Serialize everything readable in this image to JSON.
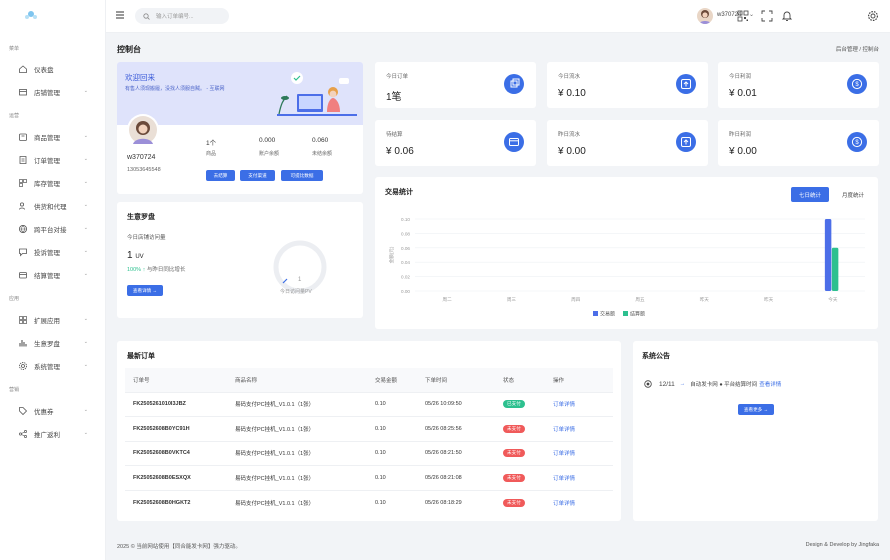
{
  "sidebar": {
    "sections": [
      "菜单",
      "运营",
      "应用",
      "营销"
    ],
    "items": [
      {
        "label": "仪表盘",
        "icon": "home-icon",
        "chev": false
      },
      {
        "label": "店铺管理",
        "icon": "store-icon",
        "chev": true
      },
      {
        "label": "商品管理",
        "icon": "goods-icon",
        "chev": true
      },
      {
        "label": "订单管理",
        "icon": "order-icon",
        "chev": true
      },
      {
        "label": "库存管理",
        "icon": "stock-icon",
        "chev": true
      },
      {
        "label": "供货和代理",
        "icon": "users-icon",
        "chev": true
      },
      {
        "label": "跨平台对接",
        "icon": "globe-icon",
        "chev": true
      },
      {
        "label": "投诉管理",
        "icon": "complaint-icon",
        "chev": true
      },
      {
        "label": "结算管理",
        "icon": "wallet-icon",
        "chev": true
      },
      {
        "label": "扩展应用",
        "icon": "apps-icon",
        "chev": true
      },
      {
        "label": "生意罗盘",
        "icon": "bar-chart-icon",
        "chev": true
      },
      {
        "label": "系统管理",
        "icon": "gear-icon",
        "chev": true
      },
      {
        "label": "优惠券",
        "icon": "tag-icon",
        "chev": true
      },
      {
        "label": "推广返利",
        "icon": "share-icon",
        "chev": true
      }
    ]
  },
  "topbar": {
    "search_placeholder": "输入订单编号...",
    "username": "w370724",
    "user_chevron": "⌄"
  },
  "page": {
    "title": "控制台",
    "breadcrumb": "后台管理 / 控制台"
  },
  "welcome": {
    "title": "欢迎回来",
    "subtitle": "有售人须现搬履，没找人须服自贼。 - 互联网",
    "user": "w370724",
    "phone": "13053645548",
    "stats": [
      {
        "value": "1个",
        "label": "商品"
      },
      {
        "value": "0.000",
        "label": "账户余额"
      },
      {
        "value": "0.060",
        "label": "未结余额"
      }
    ],
    "buttons": [
      "去结算",
      "支付渠道",
      "可提比数据"
    ]
  },
  "stats": [
    {
      "label": "今日订单",
      "value": "1笔",
      "icon": "stack-icon"
    },
    {
      "label": "今日流水",
      "value": "¥ 0.10",
      "icon": "upload-icon"
    },
    {
      "label": "今日利润",
      "value": "¥ 0.01",
      "icon": "dollar-icon"
    },
    {
      "label": "待结算",
      "value": "¥ 0.06",
      "icon": "card-icon"
    },
    {
      "label": "昨日流水",
      "value": "¥ 0.00",
      "icon": "upload-icon"
    },
    {
      "label": "昨日利润",
      "value": "¥ 0.00",
      "icon": "dollar-icon"
    }
  ],
  "compass": {
    "title": "生意罗盘",
    "subtitle": "今日店铺访问量",
    "value": "1",
    "unit": "UV",
    "growth": "100% ↑",
    "growth_text": "与昨日同比增长",
    "button": "查看详情 →",
    "gauge_value": "1",
    "gauge_label": "今日访问量PV"
  },
  "chart_data": {
    "type": "bar",
    "title": "交易统计",
    "tabs": [
      "七日统计",
      "月度统计"
    ],
    "categories": [
      "周二",
      "周三",
      "周四",
      "周五",
      "昨天",
      "昨天",
      "今天"
    ],
    "ylabel": "金额(元)",
    "ylim": [
      0,
      0.1
    ],
    "yticks": [
      "0.00",
      "0.02",
      "0.04",
      "0.06",
      "0.08",
      "0.10"
    ],
    "series": [
      {
        "name": "交易额",
        "color": "#4c6ee8",
        "values": [
          0,
          0,
          0,
          0,
          0,
          0,
          0.1
        ]
      },
      {
        "name": "结算额",
        "color": "#2dc08f",
        "values": [
          0,
          0,
          0,
          0,
          0,
          0,
          0.06
        ]
      }
    ],
    "legend": "bottom",
    "grid": true
  },
  "orders": {
    "title": "最新订单",
    "headers": [
      "订单号",
      "商品名称",
      "交易金额",
      "下单时间",
      "状态",
      "操作"
    ],
    "rows": [
      {
        "id": "FK2505261010I3JBZ",
        "name": "易码支付PC挂机_V1.0.1（1张）",
        "amount": "0.10",
        "time": "05/26 10:09:50",
        "status": "已支付",
        "color": "#2dc08f",
        "action": "订单详情"
      },
      {
        "id": "FK25052608B0YC91H",
        "name": "易码支付PC挂机_V1.0.1（1张）",
        "amount": "0.10",
        "time": "05/26 08:25:56",
        "status": "未支付",
        "color": "#f05a5a",
        "action": "订单详情"
      },
      {
        "id": "FK25052608B0VKTC4",
        "name": "易码支付PC挂机_V1.0.1（1张）",
        "amount": "0.10",
        "time": "05/26 08:21:50",
        "status": "未支付",
        "color": "#f05a5a",
        "action": "订单详情"
      },
      {
        "id": "FK25052608B0ESXQX",
        "name": "易码支付PC挂机_V1.0.1（1张）",
        "amount": "0.10",
        "time": "05/26 08:21:08",
        "status": "未支付",
        "color": "#f05a5a",
        "action": "订单详情"
      },
      {
        "id": "FK25052608B0HGKT2",
        "name": "易码支付PC挂机_V1.0.1（1张）",
        "amount": "0.10",
        "time": "05/26 08:18:29",
        "status": "未支付",
        "color": "#f05a5a",
        "action": "订单详情"
      }
    ]
  },
  "notice": {
    "title": "系统公告",
    "date": "12/11",
    "text": "自动发卡网 ● 平台结算时间",
    "link": "查看详情",
    "button": "查看更多 →"
  },
  "footer": {
    "left": "2025 © 当前网站使用【同合能发卡网】强力驱动。",
    "right": "Design & Develop by Jingfaka"
  }
}
